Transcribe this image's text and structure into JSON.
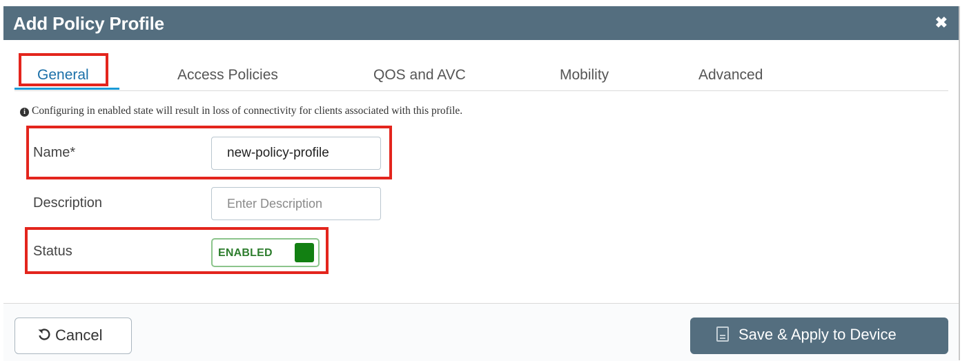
{
  "dialog": {
    "title": "Add Policy Profile",
    "close_icon": "✖"
  },
  "tabs": [
    {
      "label": "General",
      "active": true
    },
    {
      "label": "Access Policies"
    },
    {
      "label": "QOS and AVC"
    },
    {
      "label": "Mobility"
    },
    {
      "label": "Advanced"
    }
  ],
  "notice": {
    "icon": "info-icon",
    "text": "Configuring in enabled state will result in loss of connectivity for clients associated with this profile."
  },
  "form": {
    "name_label": "Name*",
    "name_value": "new-policy-profile",
    "description_label": "Description",
    "description_placeholder": "Enter Description",
    "status_label": "Status",
    "status_value": "ENABLED"
  },
  "footer": {
    "cancel_label": "Cancel",
    "save_label": "Save & Apply to Device"
  },
  "colors": {
    "titlebar": "#546e7f",
    "highlight": "#e3251d",
    "enabled": "#128012",
    "active_tab": "#1a9ad6"
  }
}
